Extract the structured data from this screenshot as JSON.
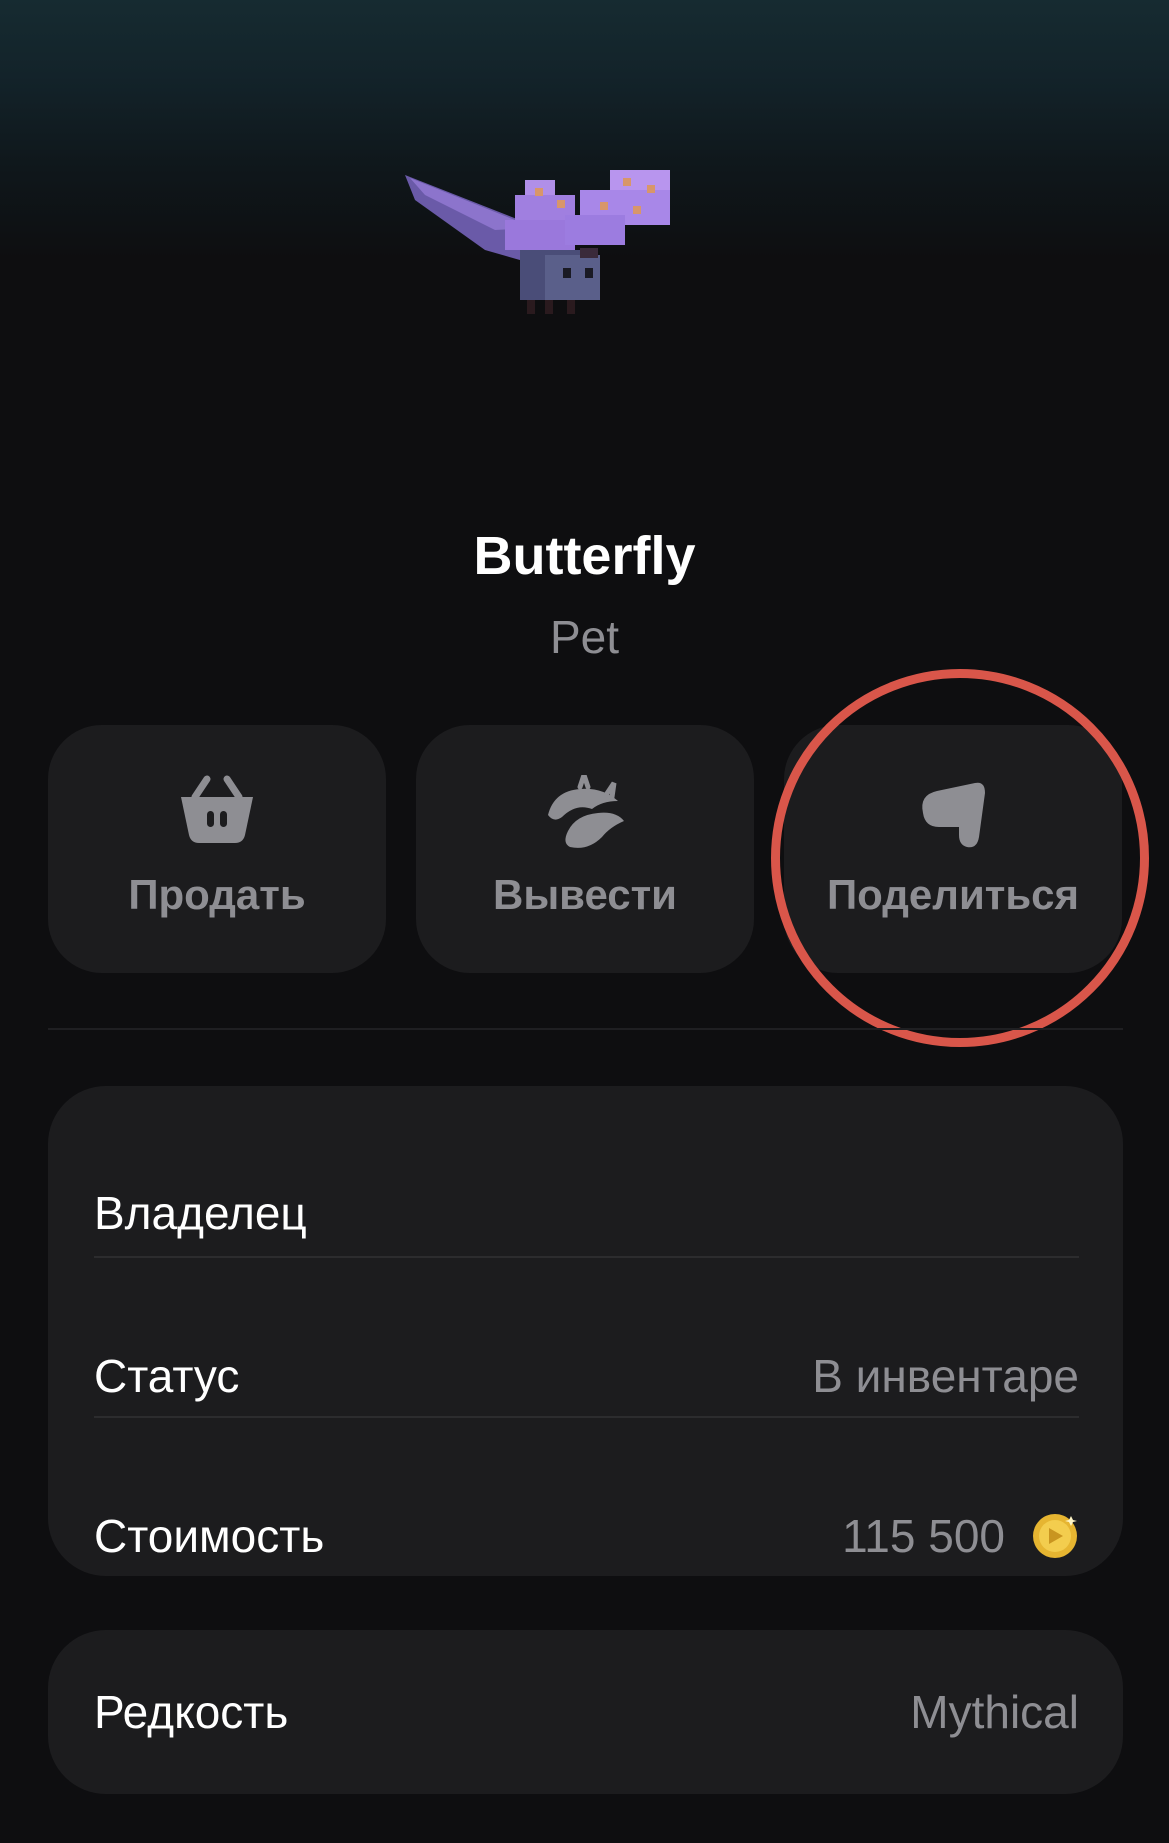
{
  "item": {
    "name": "Butterfly",
    "type": "Pet"
  },
  "actions": [
    {
      "label": "Продать",
      "icon": "basket-icon"
    },
    {
      "label": "Вывести",
      "icon": "withdraw-icon"
    },
    {
      "label": "Поделиться",
      "icon": "share-icon"
    }
  ],
  "details": {
    "owner_label": "Владелец",
    "status_label": "Статус",
    "status_value": "В инвентаре",
    "price_label": "Стоимость",
    "price_value": "115 500",
    "price_icon": "coin-icon",
    "rarity_label": "Редкость",
    "rarity_value": "Mythical"
  },
  "colors": {
    "background": "#0e0e10",
    "card": "#1c1c1e",
    "muted_text": "#8e8e93",
    "highlight_circle": "#d9564a"
  }
}
